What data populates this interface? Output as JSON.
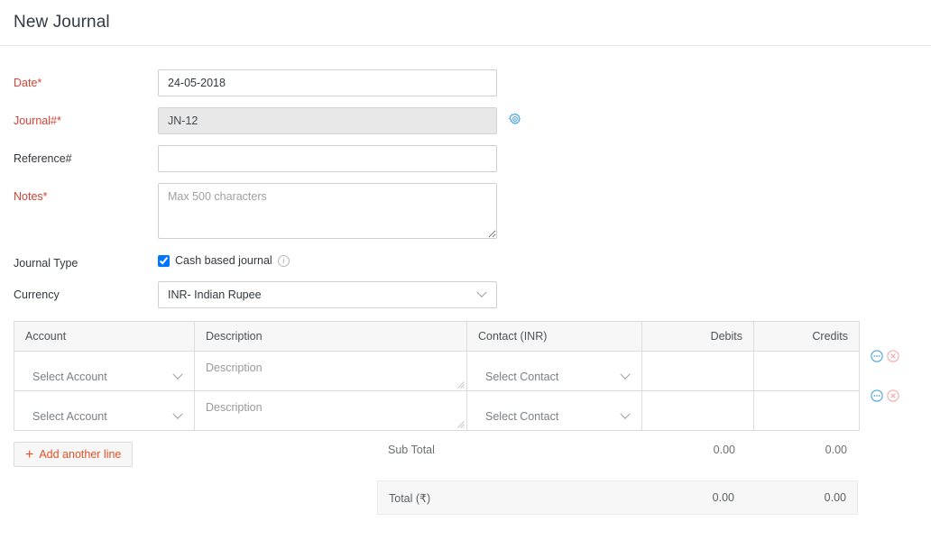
{
  "header": {
    "title": "New Journal"
  },
  "form": {
    "date": {
      "label": "Date",
      "required": true,
      "value": "24-05-2018",
      "placeholder": ""
    },
    "journal_no": {
      "label": "Journal#",
      "required": true,
      "value": "JN-12",
      "readonly": true,
      "settings_icon": "gear-icon"
    },
    "reference_no": {
      "label": "Reference#",
      "required": false,
      "value": "",
      "placeholder": ""
    },
    "notes": {
      "label": "Notes",
      "required": true,
      "value": "",
      "placeholder": "Max 500 characters"
    },
    "journal_type": {
      "label": "Journal Type",
      "checkbox_label": "Cash based journal",
      "checked": true,
      "info_icon": "info-icon"
    },
    "currency": {
      "label": "Currency",
      "value": "INR- Indian Rupee",
      "options": [
        "INR- Indian Rupee"
      ]
    }
  },
  "line_items": {
    "columns": [
      {
        "label": "Account",
        "align": "left"
      },
      {
        "label": "Description",
        "align": "left"
      },
      {
        "label": "Contact (INR)",
        "align": "left"
      },
      {
        "label": "Debits",
        "align": "right"
      },
      {
        "label": "Credits",
        "align": "right"
      }
    ],
    "rows": [
      {
        "account": "Select Account",
        "description": "Description",
        "contact": "Select Contact",
        "debits": "",
        "credits": "",
        "actions": [
          "more-options-icon",
          "remove-row-icon"
        ]
      },
      {
        "account": "Select Account",
        "description": "Description",
        "contact": "Select Contact",
        "debits": "",
        "credits": "",
        "actions": [
          "more-options-icon",
          "remove-row-icon"
        ]
      }
    ]
  },
  "actions": {
    "add_line": {
      "label": "Add another line",
      "icon": "plus-icon"
    }
  },
  "totals": {
    "sub_total": {
      "label": "Sub Total",
      "debits": "0.00",
      "credits": "0.00"
    },
    "grand_total": {
      "label": "Total (₹)",
      "debits": "0.00",
      "credits": "0.00"
    }
  },
  "colors": {
    "accent_orange": "#e65023",
    "required_red": "#d04437",
    "icon_blue": "#4ba3dd",
    "icon_pink": "#f2a0a0",
    "border": "#dcdcdc",
    "header_bg": "#f7f7f7"
  }
}
